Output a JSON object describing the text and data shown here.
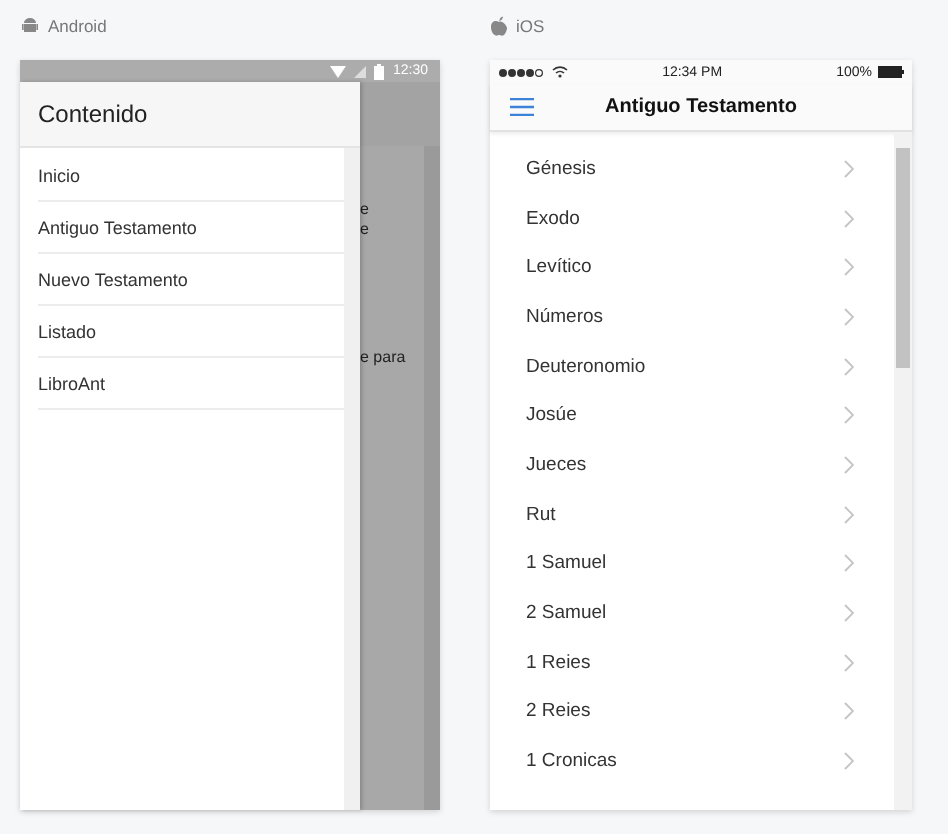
{
  "android": {
    "label": "Android",
    "status_time": "12:30",
    "drawer": {
      "title": "Contenido",
      "items": [
        {
          "label": "Inicio"
        },
        {
          "label": "Antiguo Testamento"
        },
        {
          "label": "Nuevo Testamento"
        },
        {
          "label": "Listado"
        },
        {
          "label": "LibroAnt"
        }
      ]
    },
    "behind_fragments": [
      "e",
      "e",
      "e para"
    ]
  },
  "ios": {
    "label": "iOS",
    "status_time": "12:34 PM",
    "battery": "100%",
    "title": "Antiguo Testamento",
    "items": [
      {
        "label": "Génesis"
      },
      {
        "label": "Exodo"
      },
      {
        "label": "Levítico"
      },
      {
        "label": "Números"
      },
      {
        "label": "Deuteronomio"
      },
      {
        "label": "Josúe"
      },
      {
        "label": "Jueces"
      },
      {
        "label": "Rut"
      },
      {
        "label": "1 Samuel"
      },
      {
        "label": "2 Samuel"
      },
      {
        "label": "1 Reies"
      },
      {
        "label": "2 Reies"
      },
      {
        "label": "1 Cronicas"
      }
    ]
  }
}
